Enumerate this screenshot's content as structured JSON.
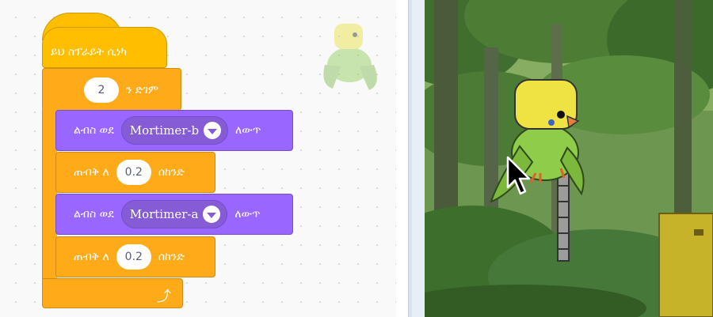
{
  "workspace": {
    "hat_label": "ይህ ስፕራይት ሲነካ",
    "repeat": {
      "times": "2",
      "suffix": "ን ድገም"
    },
    "switch_costume_1": {
      "prefix": "ልብስ ወደ",
      "costume": "Mortimer-b",
      "suffix": "ለውጥ"
    },
    "wait_1": {
      "prefix": "ጠብቅ ለ",
      "seconds": "0.2",
      "suffix": "ሰከንድ"
    },
    "switch_costume_2": {
      "prefix": "ልብስ ወደ",
      "costume": "Mortimer-a",
      "suffix": "ለውጥ"
    },
    "wait_2": {
      "prefix": "ጠብቅ ለ",
      "seconds": "0.2",
      "suffix": "ሰከንድ"
    },
    "loop_icon": "loop-arrow-icon"
  },
  "stage": {
    "sprite": "parrot-sprite",
    "backdrop": "jungle-forest"
  },
  "colors": {
    "events": "#ffbf00",
    "control": "#ffab19",
    "looks": "#9966ff"
  }
}
